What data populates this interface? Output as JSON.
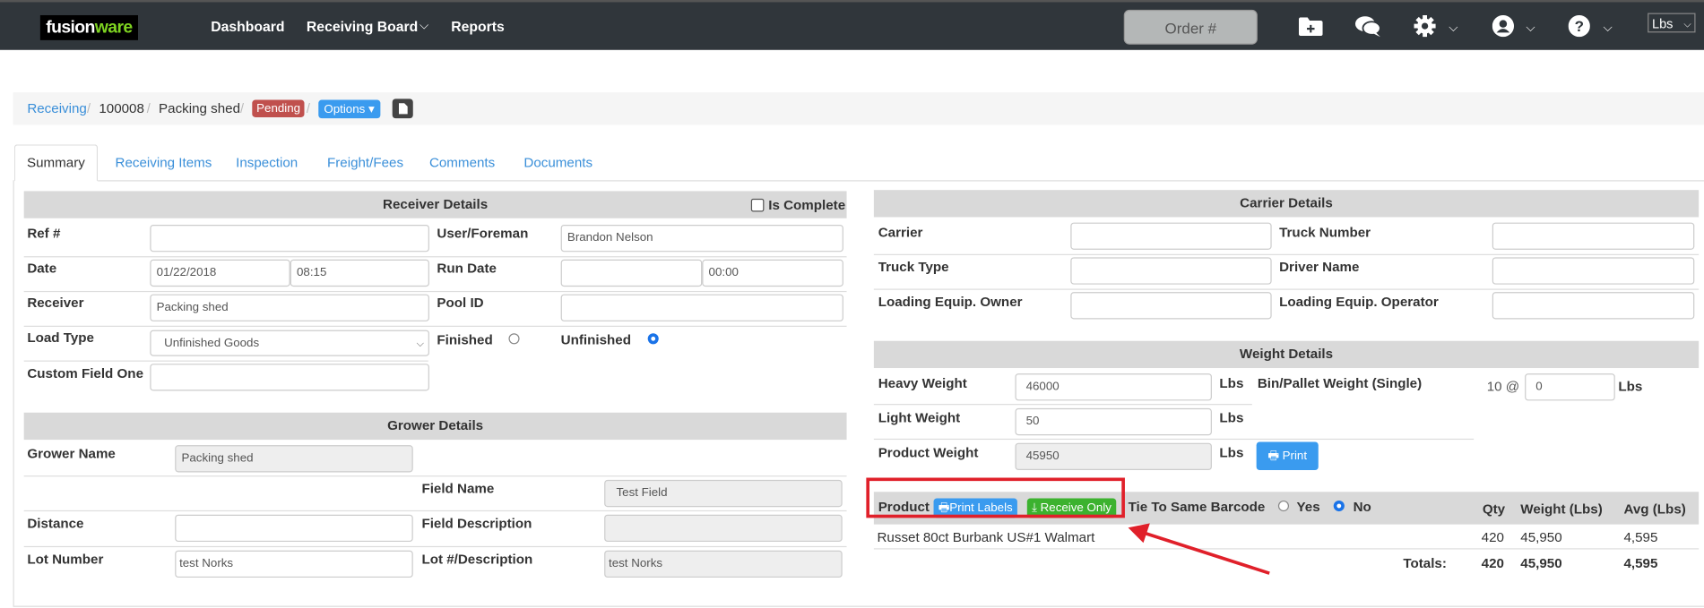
{
  "nav": {
    "logo": {
      "part1": "fusion",
      "part2": "ware"
    },
    "links": [
      "Dashboard",
      "Receiving Board",
      "Reports"
    ],
    "order_placeholder": "Order #",
    "unit_select": "Lbs",
    "icons": [
      "folder-plus-icon",
      "chat-icon",
      "gear-icon",
      "user-icon",
      "help-icon"
    ]
  },
  "breadcrumb": {
    "root": "Receiving",
    "id": "100008",
    "name": "Packing shed",
    "status": "Pending",
    "options_label": "Options",
    "colors": {
      "status": "#c0504d",
      "options": "#3a9bef"
    }
  },
  "tabs": [
    "Summary",
    "Receiving Items",
    "Inspection",
    "Freight/Fees",
    "Comments",
    "Documents"
  ],
  "receiver": {
    "title": "Receiver Details",
    "is_complete_label": "Is Complete",
    "is_complete": false,
    "ref_label": "Ref #",
    "ref": "",
    "user_label": "User/Foreman",
    "user": "Brandon Nelson",
    "date_label": "Date",
    "date": "01/22/2018",
    "time": "08:15",
    "run_date_label": "Run Date",
    "run_date": "",
    "run_time": "00:00",
    "receiver_label": "Receiver",
    "receiver": "Packing shed",
    "pool_label": "Pool ID",
    "pool": "",
    "load_type_label": "Load Type",
    "load_type": "Unfinished Goods",
    "finished_label": "Finished",
    "unfinished_label": "Unfinished",
    "selected": "Unfinished",
    "custom_label": "Custom Field One",
    "custom": ""
  },
  "grower": {
    "title": "Grower Details",
    "name_label": "Grower Name",
    "name": "Packing shed",
    "field_name_label": "Field Name",
    "field_name": "Test Field",
    "distance_label": "Distance",
    "distance": "",
    "field_desc_label": "Field Description",
    "field_desc": "",
    "lot_label": "Lot Number",
    "lot": "test Norks",
    "lot_desc_label": "Lot #/Description",
    "lot_desc": "test Norks"
  },
  "carrier": {
    "title": "Carrier Details",
    "carrier_label": "Carrier",
    "truck_number_label": "Truck Number",
    "truck_type_label": "Truck Type",
    "driver_label": "Driver Name",
    "owner_label": "Loading Equip. Owner",
    "operator_label": "Loading Equip. Operator"
  },
  "weight": {
    "title": "Weight Details",
    "heavy_label": "Heavy Weight",
    "heavy": "46000",
    "light_label": "Light Weight",
    "light": "50",
    "product_label": "Product Weight",
    "product": "45950",
    "unit": "Lbs",
    "bin_label": "Bin/Pallet Weight (Single)",
    "bin_count": "10 @",
    "bin_weight": "0",
    "print_label": "Print"
  },
  "products": {
    "product_label": "Product",
    "print_labels": "Print Labels",
    "receive_only": "Receive Only",
    "tie_label": "Tie To Same Barcode",
    "yes": "Yes",
    "no": "No",
    "tie_selected": "No",
    "columns": [
      "Qty",
      "Weight (Lbs)",
      "Avg (Lbs)"
    ],
    "rows": [
      {
        "name": "Russet 80ct Burbank US#1 Walmart",
        "qty": "420",
        "weight": "45,950",
        "avg": "4,595"
      }
    ],
    "totals": {
      "label": "Totals:",
      "qty": "420",
      "weight": "45,950",
      "avg": "4,595"
    },
    "colors": {
      "print_labels": "#3a9bef",
      "receive_only": "#3cb22f",
      "annotation": "#e0202a"
    }
  }
}
